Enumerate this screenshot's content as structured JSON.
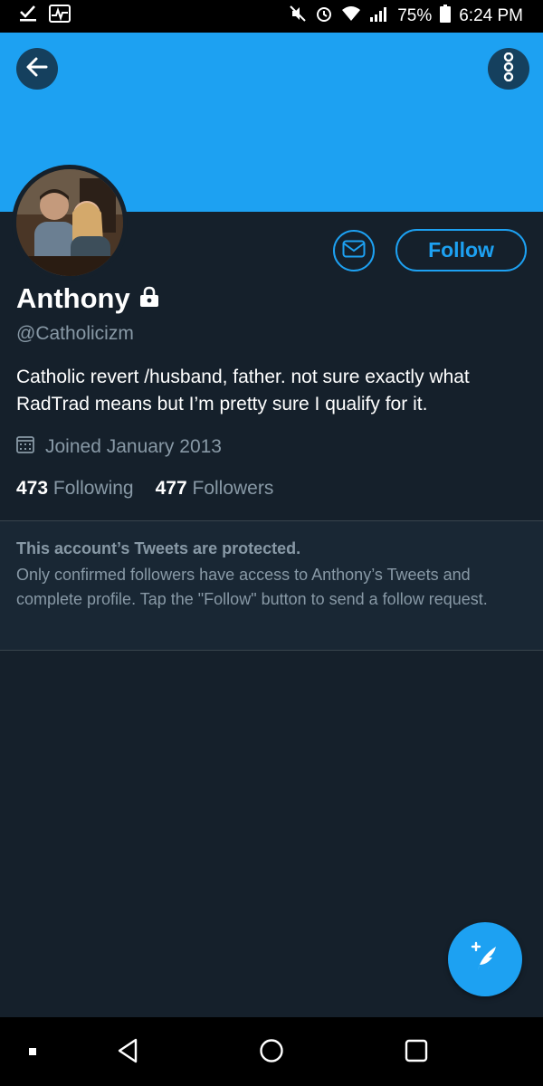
{
  "status_bar": {
    "battery": "75%",
    "time": "6:24 PM"
  },
  "profile": {
    "name": "Anthony",
    "handle": "@Catholicizm",
    "bio": "Catholic revert /husband, father. not sure exactly what RadTrad means but I’m pretty sure I qualify for it.",
    "joined": "Joined January 2013",
    "following_count": "473",
    "following_label": "Following",
    "followers_count": "477",
    "followers_label": "Followers"
  },
  "actions": {
    "follow_label": "Follow"
  },
  "protected_notice": {
    "title": "This account’s Tweets are protected.",
    "body": "Only confirmed followers have access to Anthony’s Tweets and complete profile. Tap the \"Follow\" button to send a follow request."
  },
  "icons": {
    "back": "back-arrow-icon",
    "more": "more-vertical-icon",
    "message": "envelope-icon",
    "lock": "lock-icon",
    "calendar": "calendar-icon",
    "compose": "compose-tweet-icon"
  },
  "colors": {
    "accent": "#1da1f2",
    "background": "#15202b",
    "secondary_text": "#8899a6"
  }
}
